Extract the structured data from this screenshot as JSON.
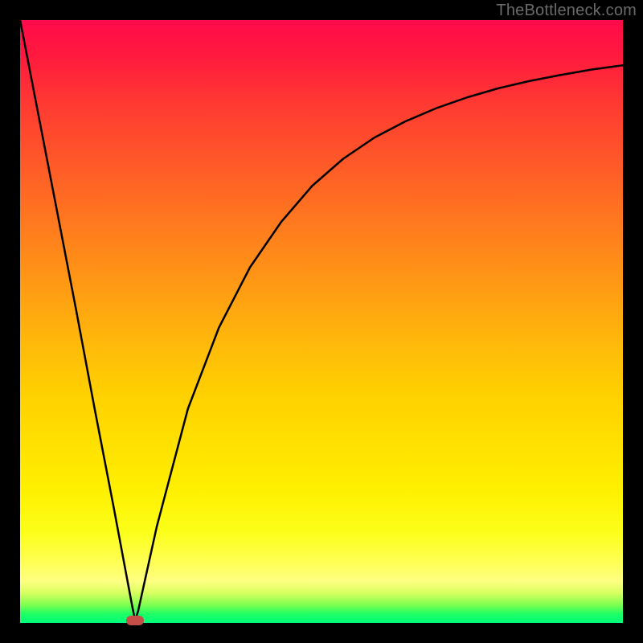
{
  "watermark": "TheBottleneck.com",
  "colors": {
    "background": "#000000",
    "curve": "#000000",
    "marker": "#c64e48"
  },
  "chart_data": {
    "type": "line",
    "title": "",
    "xlabel": "",
    "ylabel": "",
    "xlim": [
      0.03,
      1.0
    ],
    "ylim": [
      0.0,
      1.0
    ],
    "grid": false,
    "legend": false,
    "series": [
      {
        "name": "bottleneck-curve",
        "x": [
          0.03,
          0.06,
          0.09,
          0.12,
          0.15,
          0.18,
          0.21,
          0.215,
          0.22,
          0.25,
          0.3,
          0.35,
          0.4,
          0.45,
          0.5,
          0.55,
          0.6,
          0.65,
          0.7,
          0.75,
          0.8,
          0.85,
          0.9,
          0.95,
          1.0
        ],
        "y": [
          1.0,
          0.84,
          0.68,
          0.52,
          0.355,
          0.195,
          0.03,
          0.004,
          0.02,
          0.16,
          0.355,
          0.49,
          0.59,
          0.665,
          0.725,
          0.77,
          0.805,
          0.832,
          0.854,
          0.872,
          0.887,
          0.899,
          0.909,
          0.918,
          0.925
        ]
      }
    ],
    "markers": [
      {
        "x": 0.215,
        "y": 0.004,
        "shape": "rounded-rect",
        "color": "#c64e48"
      }
    ],
    "background_gradient": {
      "orientation": "vertical",
      "stops": [
        {
          "pos": 0.0,
          "color": "#ff0a4a"
        },
        {
          "pos": 0.5,
          "color": "#ffba0a"
        },
        {
          "pos": 0.8,
          "color": "#fff000"
        },
        {
          "pos": 1.0,
          "color": "#00ff7a"
        }
      ]
    }
  }
}
